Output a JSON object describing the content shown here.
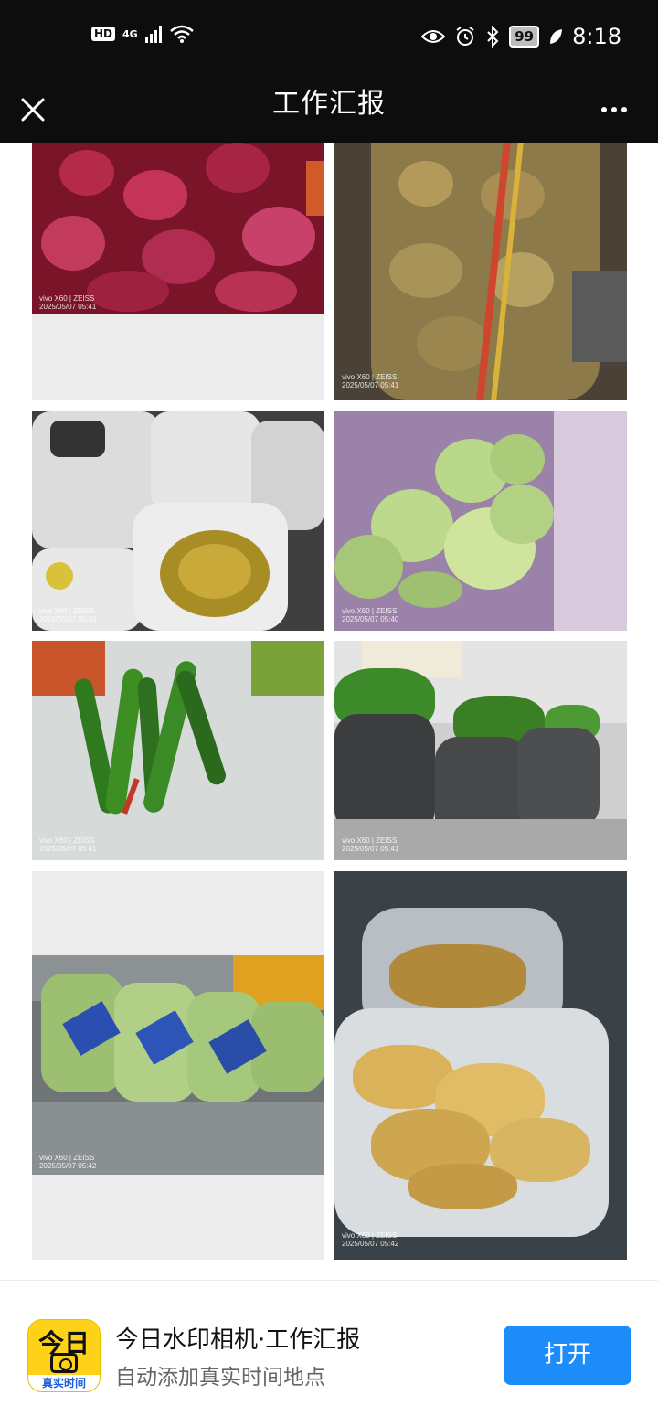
{
  "status_bar": {
    "hd": "HD",
    "network": "4G",
    "battery": "99",
    "time": "8:18"
  },
  "nav": {
    "title": "工作汇报"
  },
  "photos": [
    {
      "name": "photo-red-onions",
      "watermark": "vivo X60 | ZEISS",
      "date": "2025/05/07 05:41"
    },
    {
      "name": "photo-potatoes",
      "watermark": "vivo X60 | ZEISS",
      "date": "2025/05/07 05:41"
    },
    {
      "name": "photo-pickled-vegetables",
      "watermark": "vivo X60 | ZEISS",
      "date": "2025/05/07 05:40"
    },
    {
      "name": "photo-cabbages",
      "watermark": "vivo X60 | ZEISS",
      "date": "2025/05/07 05:40"
    },
    {
      "name": "photo-green-peppers",
      "watermark": "vivo X60 | ZEISS",
      "date": "2025/05/07 05:41"
    },
    {
      "name": "photo-leafy-greens",
      "watermark": "vivo X60 | ZEISS",
      "date": "2025/05/07 05:41"
    },
    {
      "name": "photo-bagged-vegetables",
      "watermark": "vivo X60 | ZEISS",
      "date": "2025/05/07 05:42"
    },
    {
      "name": "photo-ginger",
      "watermark": "vivo X60 | ZEISS",
      "date": "2025/05/07 05:42"
    }
  ],
  "footer": {
    "logo_top": "今日",
    "logo_bottom": "真实时间",
    "app_name": "今日水印相机·工作汇报",
    "app_desc": "自动添加真实时间地点",
    "open_label": "打开"
  }
}
